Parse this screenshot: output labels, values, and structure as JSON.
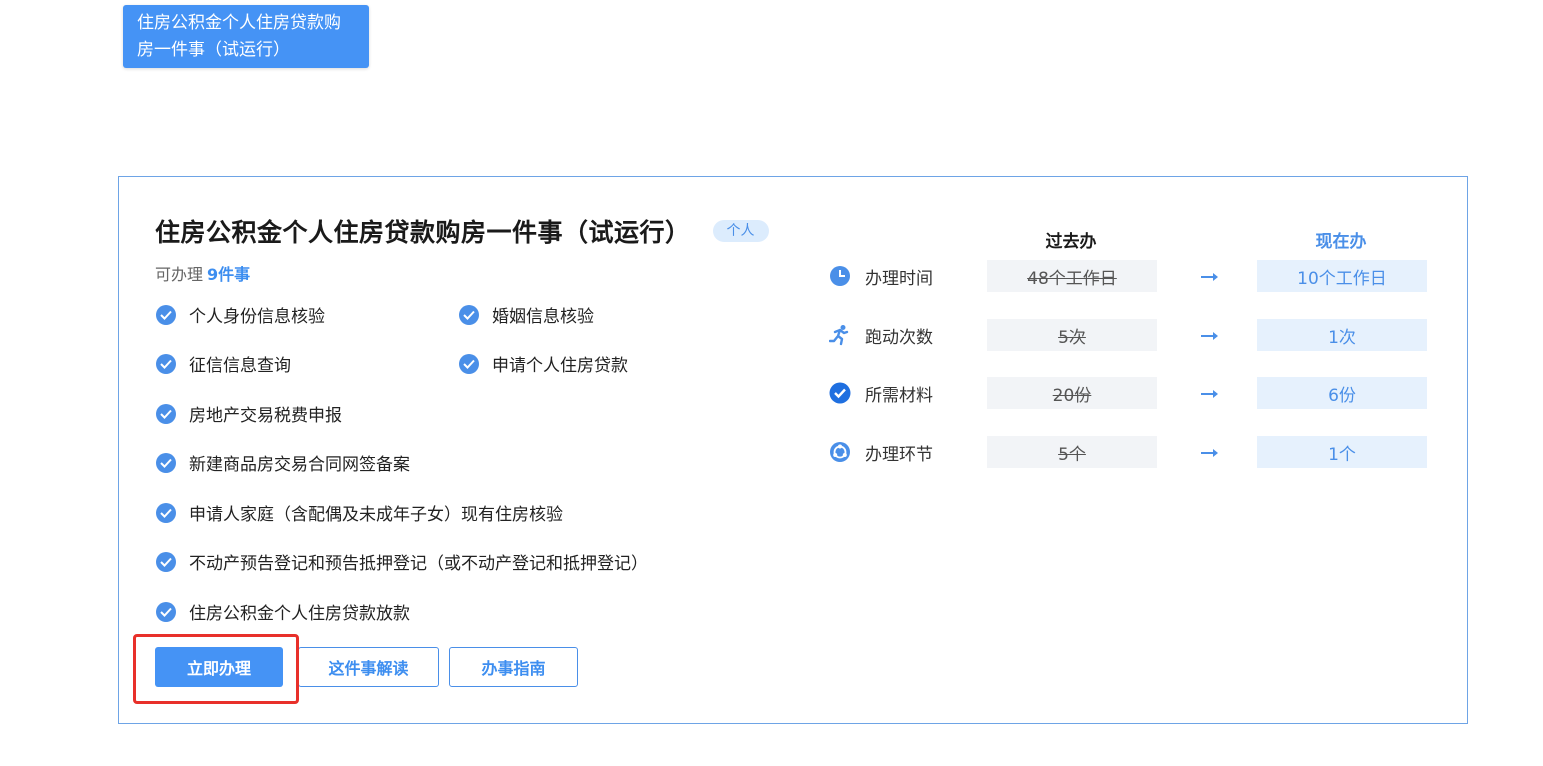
{
  "top_tab": {
    "label_line1": "住房公积金个人住房贷款购",
    "label_line2": "房一件事（试运行）"
  },
  "card": {
    "title": "住房公积金个人住房贷款购房一件事（试运行）",
    "tag": "个人",
    "count_prefix": "可办理",
    "count_value": "9件事",
    "items": [
      "个人身份信息核验",
      "婚姻信息核验",
      "征信信息查询",
      "申请个人住房贷款",
      "房地产交易税费申报",
      "新建商品房交易合同网签备案",
      "申请人家庭（含配偶及未成年子女）现有住房核验",
      "不动产预告登记和预告抵押登记（或不动产登记和抵押登记）",
      "住房公积金个人住房贷款放款"
    ],
    "buttons": {
      "apply": "立即办理",
      "interpret": "这件事解读",
      "guide": "办事指南"
    }
  },
  "comparison": {
    "past_header": "过去办",
    "now_header": "现在办",
    "rows": [
      {
        "icon": "clock-icon",
        "label": "办理时间",
        "past": "48个工作日",
        "now": "10个工作日"
      },
      {
        "icon": "running-icon",
        "label": "跑动次数",
        "past": "5次",
        "now": "1次"
      },
      {
        "icon": "check-circle-icon",
        "label": "所需材料",
        "past": "20份",
        "now": "6份"
      },
      {
        "icon": "cycle-icon",
        "label": "办理环节",
        "past": "5个",
        "now": "1个"
      }
    ]
  },
  "colors": {
    "accent": "#4593f5",
    "highlight": "#e8302a"
  }
}
